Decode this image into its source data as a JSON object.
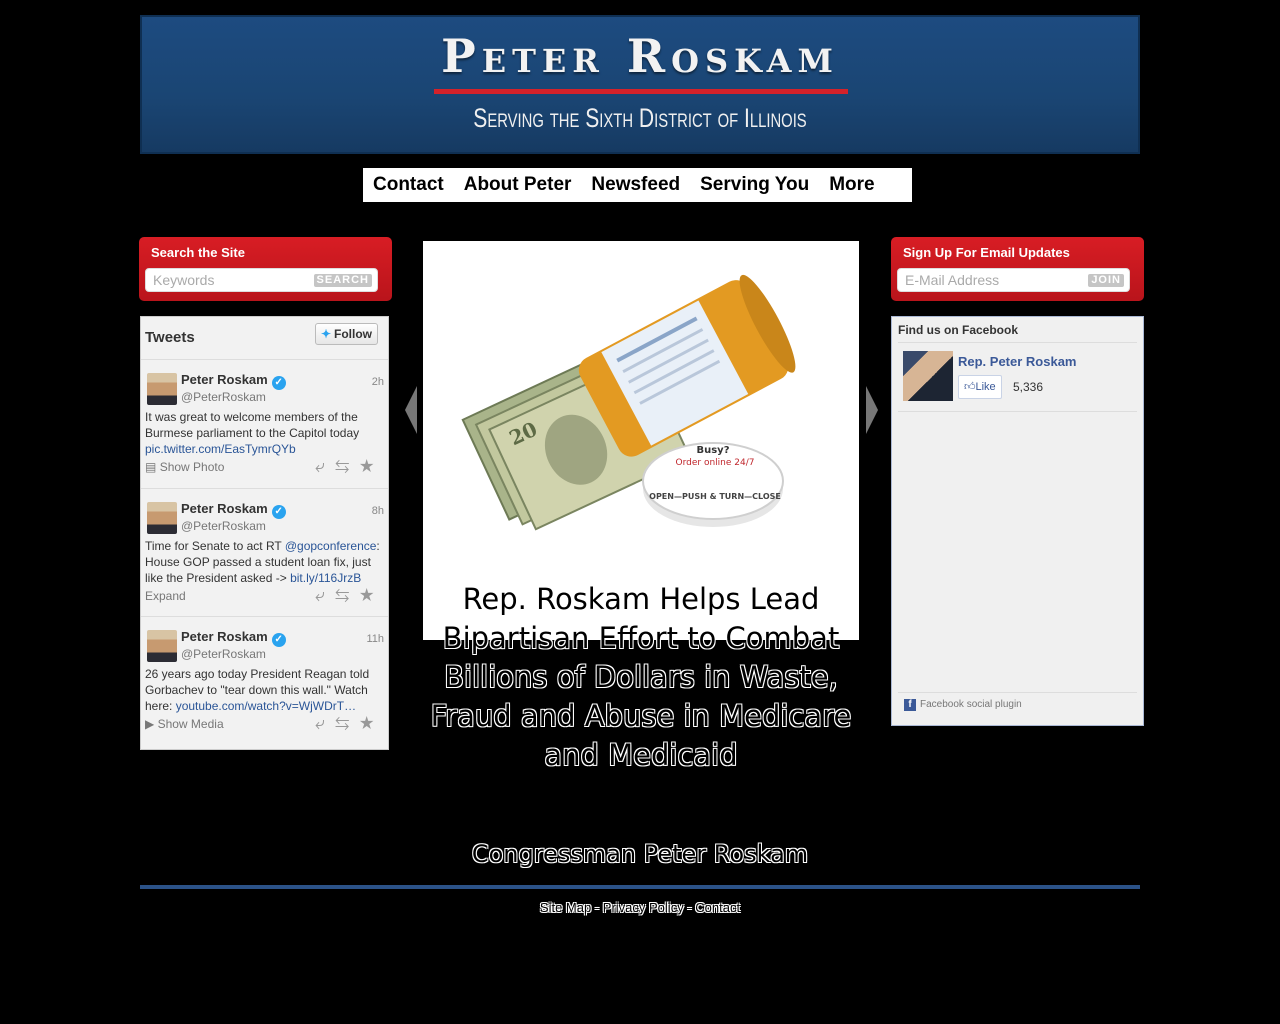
{
  "banner": {
    "name": "Peter Roskam",
    "tagline": "Serving the Sixth District of Illinois"
  },
  "nav": [
    "Contact",
    "About Peter",
    "Newsfeed",
    "Serving You",
    "More"
  ],
  "search": {
    "title": "Search the Site",
    "placeholder": "Keywords",
    "button": "SEARCH"
  },
  "email": {
    "title": "Sign Up For Email Updates",
    "placeholder": "E-Mail Address",
    "button": "JOIN"
  },
  "tweets": {
    "header": "Tweets",
    "follow_label": "Follow",
    "items": [
      {
        "name": "Peter Roskam",
        "handle": "@PeterRoskam",
        "time": "2h",
        "text_before": "It was great to welcome members of the Burmese parliament to the Capitol today ",
        "link": "pic.twitter.com/EasTymrQYb",
        "text_after": "",
        "action": "Show Photo",
        "action_icon": "photo-icon"
      },
      {
        "name": "Peter Roskam",
        "handle": "@PeterRoskam",
        "time": "8h",
        "text_before": "Time for Senate to act RT ",
        "mention": "@gopconference",
        "text_mid": ": House GOP passed a student loan fix, just like the President asked -> ",
        "link": "bit.ly/116JrzB",
        "action": "Expand"
      },
      {
        "name": "Peter Roskam",
        "handle": "@PeterRoskam",
        "time": "11h",
        "text_before": "26 years ago today President Reagan told Gorbachev to \"tear down this wall.\" Watch here: ",
        "link": "youtube.com/watch?v=WjWDrT…",
        "action": "Show Media",
        "action_icon": "play-icon"
      }
    ]
  },
  "slider": {
    "headline": "Rep. Roskam Helps Lead Bipartisan Effort to Combat Billions of Dollars in Waste, Fraud and Abuse in Medicare and Medicaid",
    "cap_text_top": "Busy?",
    "cap_text_red": "Order online 24/7",
    "cap_text_ring": "OPEN—PUSH & TURN—CLOSE"
  },
  "facebook": {
    "header": "Find us on Facebook",
    "page_name": "Rep. Peter Roskam",
    "like_label": "Like",
    "like_count": "5,336",
    "plugin_label": "Facebook social plugin"
  },
  "footer": {
    "name": "Congressman Peter Roskam",
    "links": [
      "Site Map",
      "Privacy Policy",
      "Contact"
    ],
    "separator": " - "
  }
}
